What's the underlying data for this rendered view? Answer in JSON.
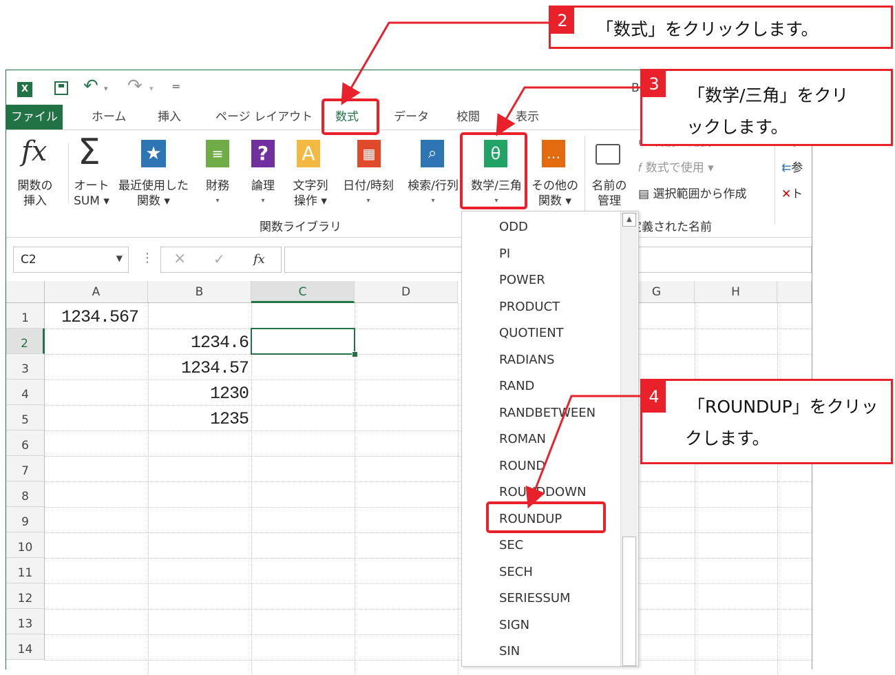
{
  "quick_access": {
    "undo_hint": "▾",
    "redo_hint": "▾",
    "customize": "="
  },
  "tabs": {
    "file": "ファイル",
    "home": "ホーム",
    "insert": "挿入",
    "page_layout": "ページ レイアウト",
    "formulas": "数式",
    "data": "データ",
    "review": "校閲",
    "view": "表示"
  },
  "title_partial": "B",
  "ribbon": {
    "insert_function": [
      "関数の",
      "挿入"
    ],
    "autosum": [
      "オート",
      "SUM ▾"
    ],
    "recent": [
      "最近使用した",
      "関数 ▾"
    ],
    "financial": "財務",
    "logical": "論理",
    "text": [
      "文字列",
      "操作 ▾"
    ],
    "datetime": "日付/時刻",
    "lookup": "検索/行列",
    "math": "数学/三角",
    "more": [
      "その他の",
      "関数 ▾"
    ],
    "name_manager": [
      "名前の",
      "管理"
    ],
    "define_name": "名前の定義 ▾",
    "use_in_formula": "数式で使用 ▾",
    "create_from_selection": "選択範囲から作成",
    "group_library": "関数ライブラリ",
    "group_names": "定義された名前",
    "trace_prec": "参",
    "trace_dep": "参",
    "remove_arrows": "ト"
  },
  "formula_bar": {
    "name_box": "C2",
    "cancel": "×",
    "enter": "✓",
    "fx": "fx"
  },
  "columns": [
    "A",
    "B",
    "C",
    "D",
    "G",
    "H"
  ],
  "rows": [
    "1",
    "2",
    "3",
    "4",
    "5",
    "6",
    "7",
    "8",
    "9",
    "10",
    "11",
    "12",
    "13",
    "14"
  ],
  "cells": {
    "A1": "1234.567",
    "B2": "1234.6",
    "B3": "1234.57",
    "B4": "1230",
    "B5": "1235"
  },
  "dropdown_items": [
    "ODD",
    "PI",
    "POWER",
    "PRODUCT",
    "QUOTIENT",
    "RADIANS",
    "RAND",
    "RANDBETWEEN",
    "ROMAN",
    "ROUND",
    "ROUNDDOWN",
    "ROUNDUP",
    "SEC",
    "SECH",
    "SERIESSUM",
    "SIGN",
    "SIN"
  ],
  "callouts": {
    "c2": {
      "num": "2",
      "text": "「数式」をクリックします。"
    },
    "c3": {
      "num": "3",
      "line1": "「数学/三角」をクリ",
      "line2": "ックします。"
    },
    "c4": {
      "num": "4",
      "line1": "「ROUNDUP」をクリッ",
      "line2": "クします。"
    }
  },
  "colors": {
    "excel_green": "#217346",
    "callout_red": "#e8212a"
  }
}
